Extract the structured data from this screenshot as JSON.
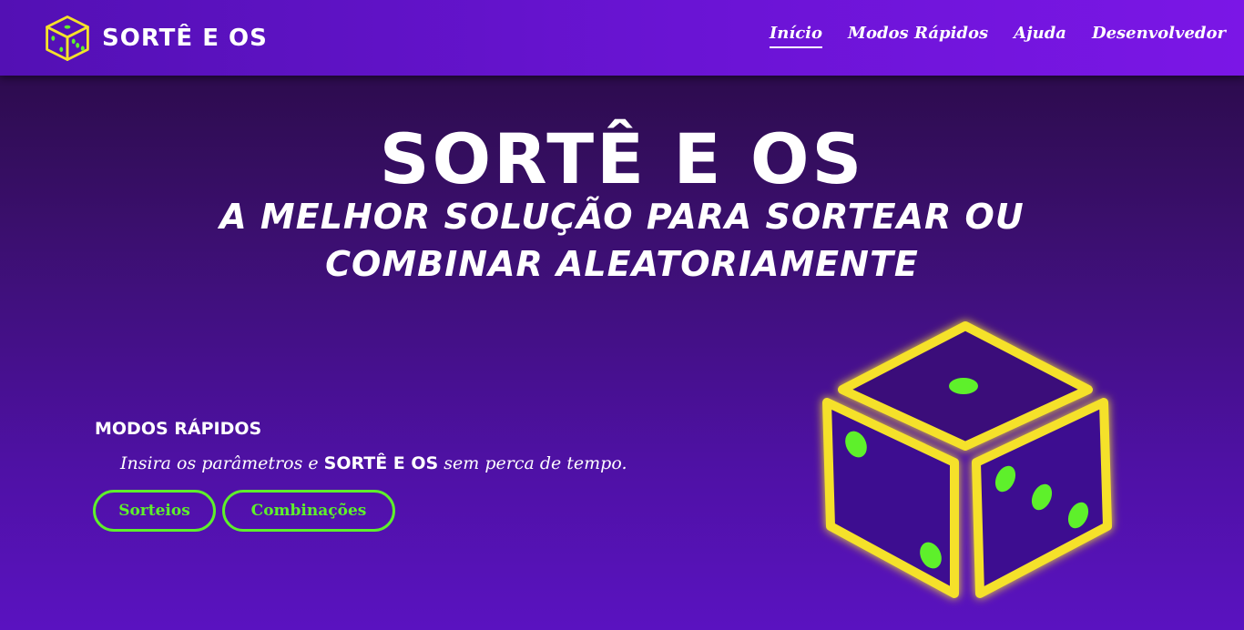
{
  "header": {
    "brand": "SORTÊ E OS",
    "logo_icon": "dice-icon",
    "nav": [
      {
        "label": "Início",
        "active": true
      },
      {
        "label": "Modos Rápidos",
        "active": false
      },
      {
        "label": "Ajuda",
        "active": false
      },
      {
        "label": "Desenvolvedor",
        "active": false
      }
    ]
  },
  "hero": {
    "title": "SORTÊ E OS",
    "subtitle": "A MELHOR SOLUÇÃO PARA SORTEAR OU COMBINAR ALEATORIAMENTE",
    "illustration_icon": "dice-icon"
  },
  "quick_modes": {
    "title": "MODOS RÁPIDOS",
    "desc_before": "Insira os parâmetros e ",
    "desc_brand": "SORTÊ E OS",
    "desc_after": " sem perca de tempo.",
    "buttons": [
      {
        "label": "Sorteios"
      },
      {
        "label": "Combinações"
      }
    ]
  },
  "colors": {
    "header": "#6a14d4",
    "background_top": "#260a3e",
    "background_bottom": "#5a12c0",
    "accent_green": "#5ef02b",
    "dice_outline": "#f5e12a"
  }
}
